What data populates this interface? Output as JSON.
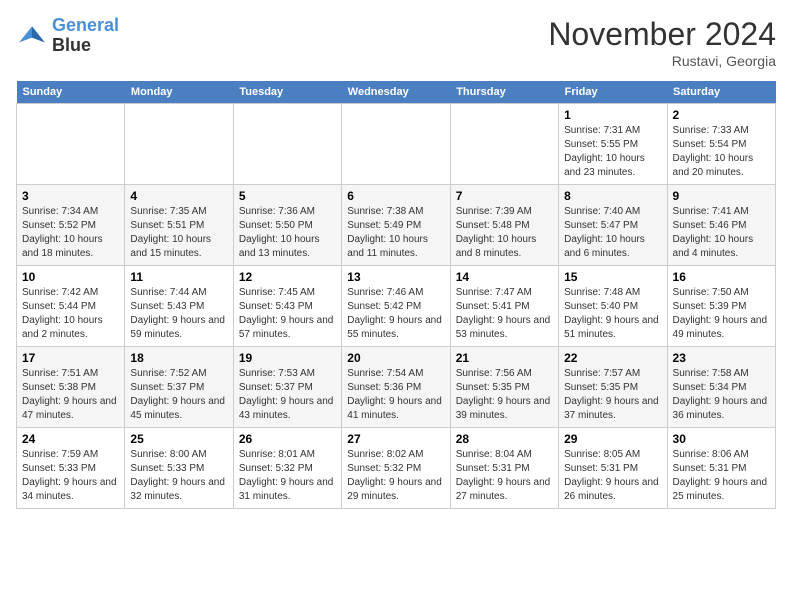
{
  "header": {
    "logo_line1": "General",
    "logo_line2": "Blue",
    "month": "November 2024",
    "location": "Rustavi, Georgia"
  },
  "weekdays": [
    "Sunday",
    "Monday",
    "Tuesday",
    "Wednesday",
    "Thursday",
    "Friday",
    "Saturday"
  ],
  "weeks": [
    [
      {
        "day": "",
        "info": ""
      },
      {
        "day": "",
        "info": ""
      },
      {
        "day": "",
        "info": ""
      },
      {
        "day": "",
        "info": ""
      },
      {
        "day": "",
        "info": ""
      },
      {
        "day": "1",
        "info": "Sunrise: 7:31 AM\nSunset: 5:55 PM\nDaylight: 10 hours and 23 minutes."
      },
      {
        "day": "2",
        "info": "Sunrise: 7:33 AM\nSunset: 5:54 PM\nDaylight: 10 hours and 20 minutes."
      }
    ],
    [
      {
        "day": "3",
        "info": "Sunrise: 7:34 AM\nSunset: 5:52 PM\nDaylight: 10 hours and 18 minutes."
      },
      {
        "day": "4",
        "info": "Sunrise: 7:35 AM\nSunset: 5:51 PM\nDaylight: 10 hours and 15 minutes."
      },
      {
        "day": "5",
        "info": "Sunrise: 7:36 AM\nSunset: 5:50 PM\nDaylight: 10 hours and 13 minutes."
      },
      {
        "day": "6",
        "info": "Sunrise: 7:38 AM\nSunset: 5:49 PM\nDaylight: 10 hours and 11 minutes."
      },
      {
        "day": "7",
        "info": "Sunrise: 7:39 AM\nSunset: 5:48 PM\nDaylight: 10 hours and 8 minutes."
      },
      {
        "day": "8",
        "info": "Sunrise: 7:40 AM\nSunset: 5:47 PM\nDaylight: 10 hours and 6 minutes."
      },
      {
        "day": "9",
        "info": "Sunrise: 7:41 AM\nSunset: 5:46 PM\nDaylight: 10 hours and 4 minutes."
      }
    ],
    [
      {
        "day": "10",
        "info": "Sunrise: 7:42 AM\nSunset: 5:44 PM\nDaylight: 10 hours and 2 minutes."
      },
      {
        "day": "11",
        "info": "Sunrise: 7:44 AM\nSunset: 5:43 PM\nDaylight: 9 hours and 59 minutes."
      },
      {
        "day": "12",
        "info": "Sunrise: 7:45 AM\nSunset: 5:43 PM\nDaylight: 9 hours and 57 minutes."
      },
      {
        "day": "13",
        "info": "Sunrise: 7:46 AM\nSunset: 5:42 PM\nDaylight: 9 hours and 55 minutes."
      },
      {
        "day": "14",
        "info": "Sunrise: 7:47 AM\nSunset: 5:41 PM\nDaylight: 9 hours and 53 minutes."
      },
      {
        "day": "15",
        "info": "Sunrise: 7:48 AM\nSunset: 5:40 PM\nDaylight: 9 hours and 51 minutes."
      },
      {
        "day": "16",
        "info": "Sunrise: 7:50 AM\nSunset: 5:39 PM\nDaylight: 9 hours and 49 minutes."
      }
    ],
    [
      {
        "day": "17",
        "info": "Sunrise: 7:51 AM\nSunset: 5:38 PM\nDaylight: 9 hours and 47 minutes."
      },
      {
        "day": "18",
        "info": "Sunrise: 7:52 AM\nSunset: 5:37 PM\nDaylight: 9 hours and 45 minutes."
      },
      {
        "day": "19",
        "info": "Sunrise: 7:53 AM\nSunset: 5:37 PM\nDaylight: 9 hours and 43 minutes."
      },
      {
        "day": "20",
        "info": "Sunrise: 7:54 AM\nSunset: 5:36 PM\nDaylight: 9 hours and 41 minutes."
      },
      {
        "day": "21",
        "info": "Sunrise: 7:56 AM\nSunset: 5:35 PM\nDaylight: 9 hours and 39 minutes."
      },
      {
        "day": "22",
        "info": "Sunrise: 7:57 AM\nSunset: 5:35 PM\nDaylight: 9 hours and 37 minutes."
      },
      {
        "day": "23",
        "info": "Sunrise: 7:58 AM\nSunset: 5:34 PM\nDaylight: 9 hours and 36 minutes."
      }
    ],
    [
      {
        "day": "24",
        "info": "Sunrise: 7:59 AM\nSunset: 5:33 PM\nDaylight: 9 hours and 34 minutes."
      },
      {
        "day": "25",
        "info": "Sunrise: 8:00 AM\nSunset: 5:33 PM\nDaylight: 9 hours and 32 minutes."
      },
      {
        "day": "26",
        "info": "Sunrise: 8:01 AM\nSunset: 5:32 PM\nDaylight: 9 hours and 31 minutes."
      },
      {
        "day": "27",
        "info": "Sunrise: 8:02 AM\nSunset: 5:32 PM\nDaylight: 9 hours and 29 minutes."
      },
      {
        "day": "28",
        "info": "Sunrise: 8:04 AM\nSunset: 5:31 PM\nDaylight: 9 hours and 27 minutes."
      },
      {
        "day": "29",
        "info": "Sunrise: 8:05 AM\nSunset: 5:31 PM\nDaylight: 9 hours and 26 minutes."
      },
      {
        "day": "30",
        "info": "Sunrise: 8:06 AM\nSunset: 5:31 PM\nDaylight: 9 hours and 25 minutes."
      }
    ]
  ]
}
